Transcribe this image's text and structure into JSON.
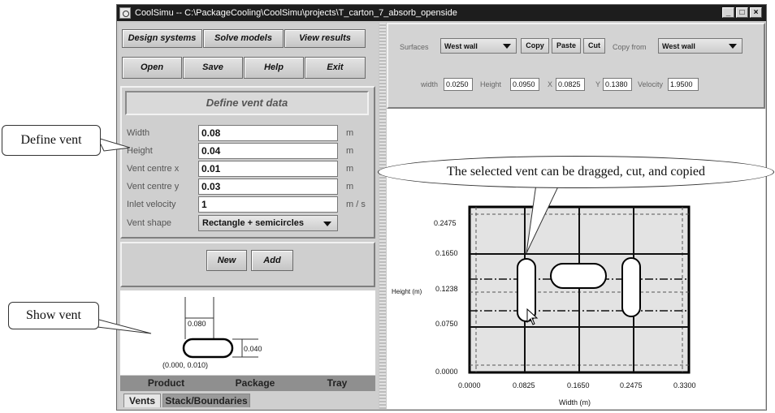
{
  "window": {
    "title": "CoolSimu -- C:\\PackageCooling\\CoolSimu\\projects\\T_carton_7_absorb_openside",
    "controls": [
      "_",
      "□",
      "×"
    ]
  },
  "menu": {
    "design": "Design systems",
    "solve": "Solve models",
    "view": "View results",
    "open": "Open",
    "save": "Save",
    "help": "Help",
    "exit": "Exit"
  },
  "vent_form": {
    "title": "Define vent data",
    "rows": [
      {
        "label": "Width",
        "value": "0.08",
        "unit": "m"
      },
      {
        "label": "Height",
        "value": "0.04",
        "unit": "m"
      },
      {
        "label": "Vent centre x",
        "value": "0.01",
        "unit": "m"
      },
      {
        "label": "Vent centre y",
        "value": "0.03",
        "unit": "m"
      },
      {
        "label": "Inlet velocity",
        "value": "1",
        "unit": "m / s"
      }
    ],
    "shape_label": "Vent shape",
    "shape_value": "Rectangle + semicircles",
    "new_label": "New",
    "add_label": "Add"
  },
  "preview": {
    "width_dim": "0.080",
    "height_dim": "0.040",
    "origin": "(0.000, 0.010)"
  },
  "tabs_top": [
    "Product",
    "Package",
    "Tray"
  ],
  "tabs_bottom": [
    "Vents",
    "Stack/Boundaries"
  ],
  "surfaces": {
    "label": "Surfaces",
    "value": "West wall",
    "copy": "Copy",
    "paste": "Paste",
    "cut": "Cut",
    "copy_from_label": "Copy from",
    "copy_from_value": "West wall"
  },
  "dims": {
    "width_label": "width",
    "width_value": "0.0250",
    "height_label": "Height",
    "height_value": "0.0950",
    "x_label": "X",
    "x_value": "0.0825",
    "y_label": "Y",
    "y_value": "0.1380",
    "velocity_label": "Velocity",
    "velocity_value": "1.9500"
  },
  "plot": {
    "ylabel": "Height (m)",
    "xlabel": "Width (m)",
    "y_ticks": [
      "0.2475",
      "0.1650",
      "0.1238",
      "0.0750",
      "0.0000"
    ],
    "x_ticks": [
      "0.0000",
      "0.0825",
      "0.1650",
      "0.2475",
      "0.3300"
    ]
  },
  "callouts": {
    "define": "Define vent",
    "show": "Show vent",
    "selected": "The selected vent can be dragged, cut, and copied"
  },
  "colors": {
    "accent": "#1d1d1d",
    "panel": "#cfcfcf"
  }
}
